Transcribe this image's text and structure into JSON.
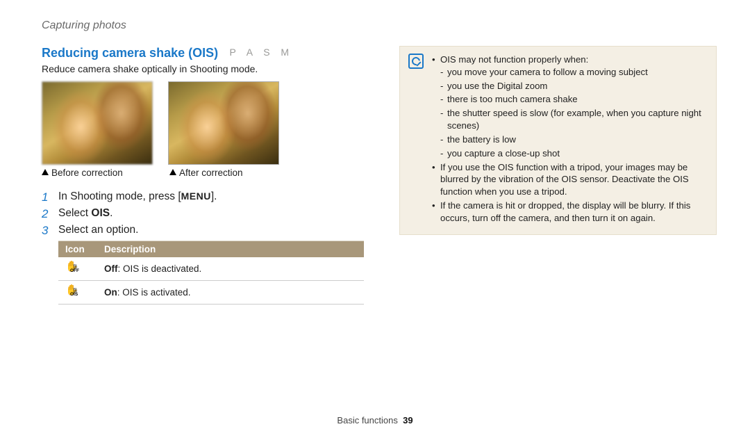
{
  "page_header": "Capturing photos",
  "section": {
    "title": "Reducing camera shake (OIS)",
    "modes": "P A S M",
    "desc": "Reduce camera shake optically in Shooting mode.",
    "caption_before": "Before correction",
    "caption_after": "After correction"
  },
  "steps": {
    "step1_prefix": "In Shooting mode, press [",
    "step1_button": "MENU",
    "step1_suffix": "].",
    "step2_prefix": "Select ",
    "step2_bold": "OIS",
    "step2_suffix": ".",
    "step3": "Select an option."
  },
  "table": {
    "head_icon": "Icon",
    "head_desc": "Description",
    "rows": [
      {
        "icon_sub": "OFF",
        "bold": "Off",
        "rest": ": OIS is deactivated."
      },
      {
        "icon_sub": "OIS",
        "bold": "On",
        "rest": ": OIS is activated."
      }
    ]
  },
  "note": {
    "intro": "OIS may not function properly when:",
    "subs": [
      "you move your camera to follow a moving subject",
      "you use the Digital zoom",
      "there is too much camera shake",
      "the shutter speed is slow (for example, when you capture night scenes)",
      "the battery is low",
      "you capture a close-up shot"
    ],
    "b2": "If you use the OIS function with a tripod, your images may be blurred by the vibration of the OIS sensor. Deactivate the OIS function when you use a tripod.",
    "b3": "If the camera is hit or dropped, the display will be blurry. If this occurs, turn off the camera, and then turn it on again."
  },
  "footer": {
    "section": "Basic functions",
    "page": "39"
  }
}
